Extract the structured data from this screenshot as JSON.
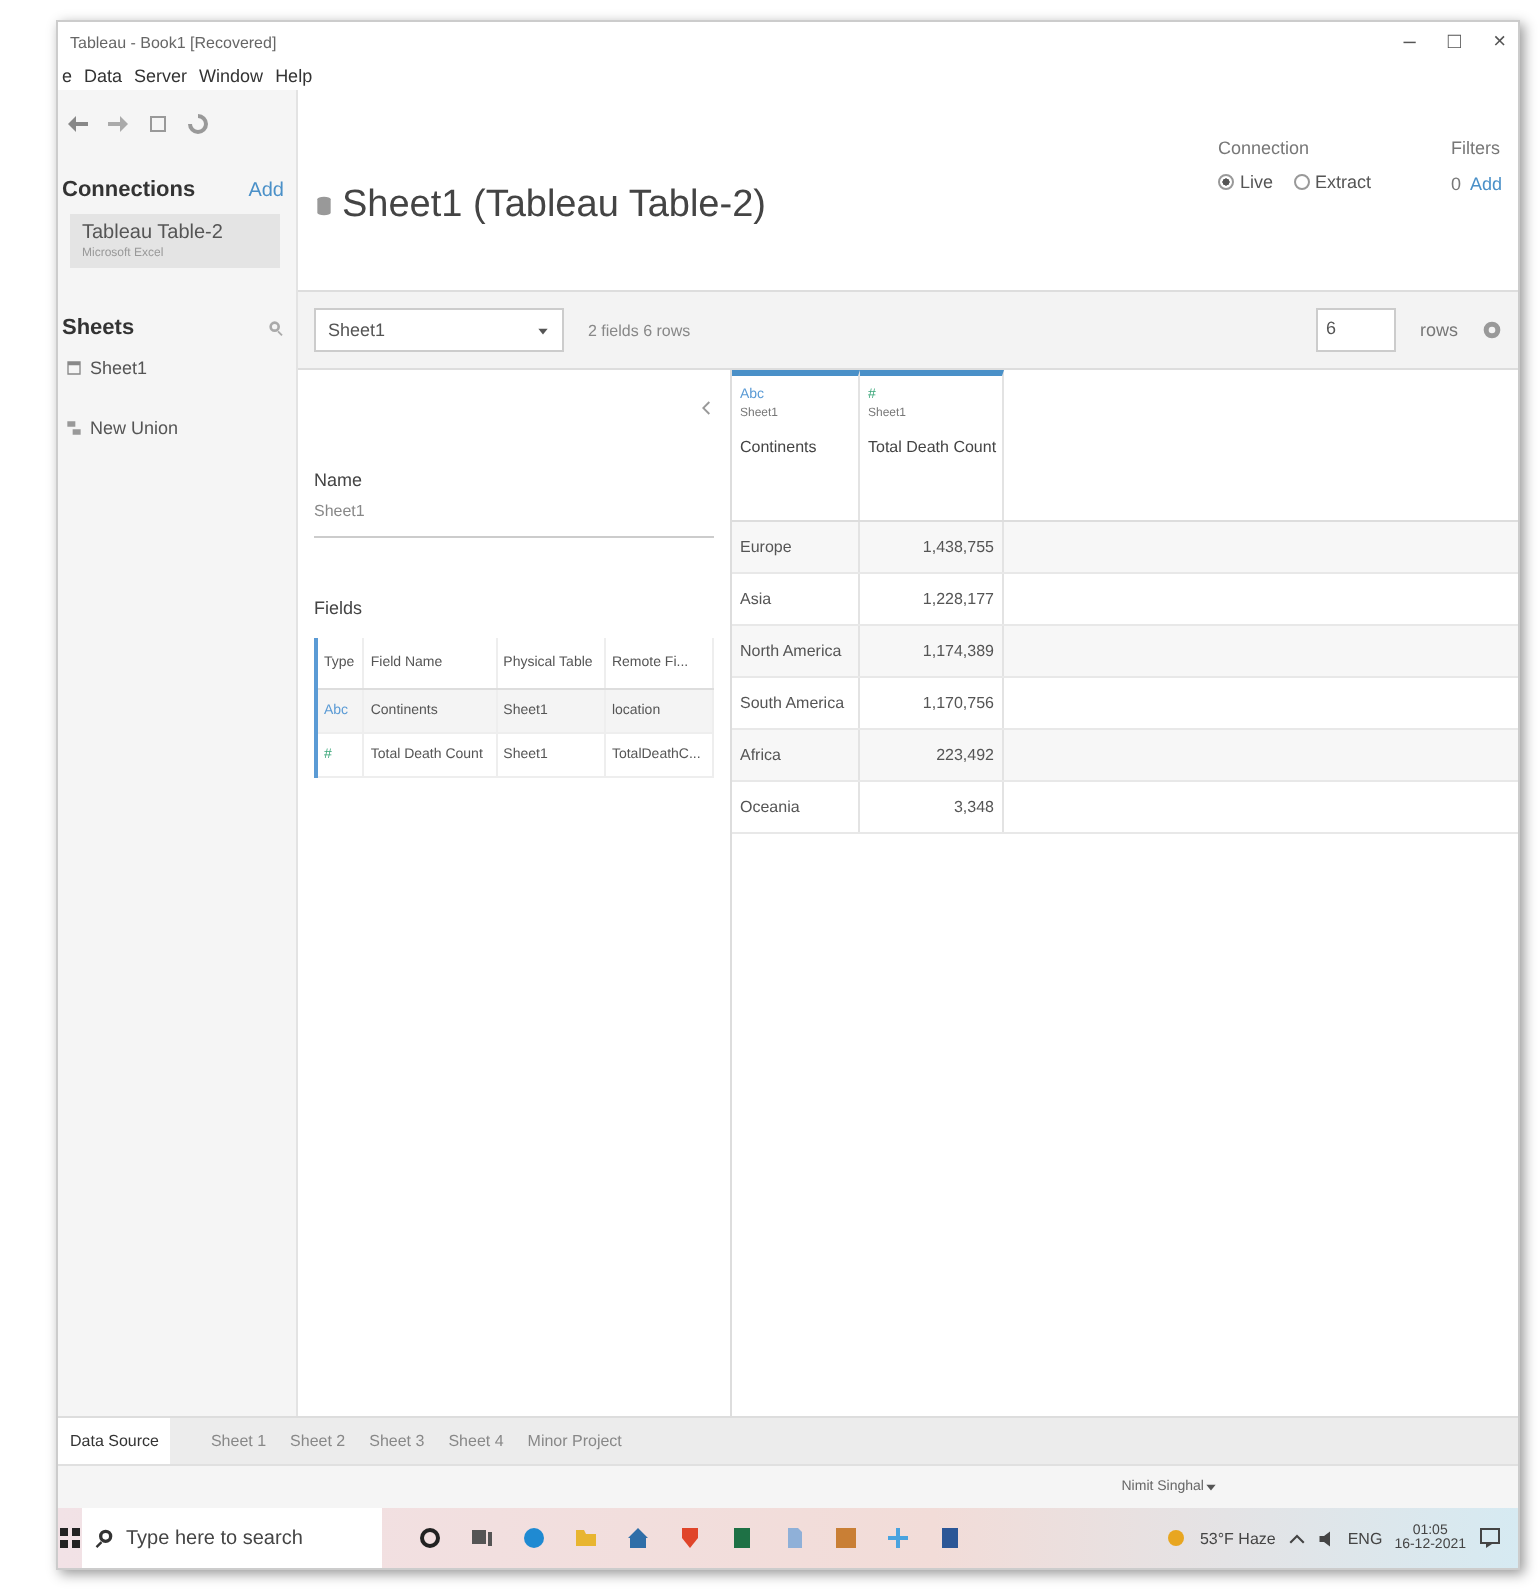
{
  "window": {
    "title": "Tableau - Book1 [Recovered]",
    "controls": [
      "–",
      "□",
      "×"
    ]
  },
  "menu": [
    "e",
    "Data",
    "Server",
    "Window",
    "Help"
  ],
  "sidebar": {
    "connections_label": "Connections",
    "add_label": "Add",
    "connections": [
      {
        "name": "Tableau Table-2",
        "type": "Microsoft Excel",
        "selected": true
      }
    ],
    "sheets_label": "Sheets",
    "sheets": [
      {
        "kind": "sheet",
        "name": "Sheet1"
      },
      {
        "kind": "union",
        "name": "New Union"
      }
    ]
  },
  "header": {
    "title": "Sheet1 (Tableau Table-2)",
    "connection_label": "Connection",
    "options": [
      {
        "label": "Live",
        "selected": true
      },
      {
        "label": "Extract",
        "selected": false
      }
    ],
    "filters_label": "Filters",
    "filters_count": "0",
    "filters_add": "Add"
  },
  "toolbar": {
    "sheet_select": "Sheet1",
    "info": "2 fields 6 rows",
    "rows_value": "6",
    "rows_label": "rows"
  },
  "details": {
    "name_label": "Name",
    "name_value": "Sheet1",
    "fields_label": "Fields",
    "columns": [
      "Type",
      "Field Name",
      "Physical Table",
      "Remote Fi..."
    ],
    "rows": [
      {
        "kind": "string",
        "cells": [
          "Abc",
          "Continents",
          "Sheet1",
          "location"
        ]
      },
      {
        "kind": "number",
        "cells": [
          "#",
          "Total Death Count",
          "Sheet1",
          "TotalDeathC..."
        ]
      }
    ]
  },
  "grid": {
    "columns": [
      {
        "type": "Abc",
        "kind": "string",
        "source": "Sheet1",
        "name": "Continents"
      },
      {
        "type": "#",
        "kind": "number",
        "source": "Sheet1",
        "name": "Total Death Count"
      }
    ],
    "rows": [
      [
        "Europe",
        "1,438,755"
      ],
      [
        "Asia",
        "1,228,177"
      ],
      [
        "North America",
        "1,174,389"
      ],
      [
        "South America",
        "1,170,756"
      ],
      [
        "Africa",
        "223,492"
      ],
      [
        "Oceania",
        "3,348"
      ]
    ]
  },
  "sheet_tabs": [
    {
      "label": "Data Source",
      "selected": true
    },
    {
      "label": "Sheet 1",
      "selected": false
    },
    {
      "label": "Sheet 2",
      "selected": false
    },
    {
      "label": "Sheet 3",
      "selected": false
    },
    {
      "label": "Sheet 4",
      "selected": false
    },
    {
      "label": "Minor Project",
      "selected": false
    }
  ],
  "status_bar": {
    "user": "Nimit Singhal"
  },
  "taskbar": {
    "search_placeholder": "Type here to search",
    "weather": "53°F Haze",
    "language": "ENG",
    "time": "01:05",
    "date": "16-12-2021"
  }
}
